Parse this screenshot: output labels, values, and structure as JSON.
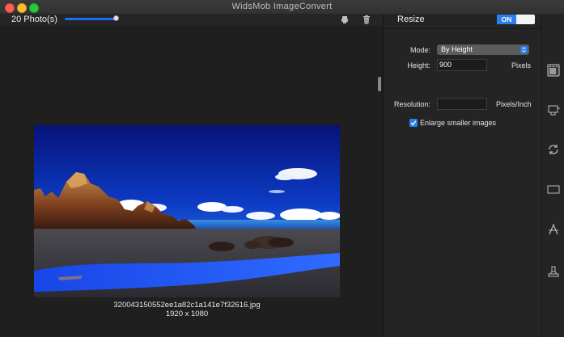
{
  "window": {
    "title": "WidsMob ImageConvert"
  },
  "toolbar": {
    "photo_count": "20 Photo(s)",
    "thumbnail_size": 1.0,
    "icons": [
      "edit-icon",
      "trash-icon"
    ]
  },
  "preview": {
    "file_name": "320043150552ee1a82c1a141e7f32616.jpg",
    "dimensions": "1920 x 1080"
  },
  "resize_panel": {
    "title": "Resize",
    "toggle_label": "ON",
    "mode_label": "Mode:",
    "mode_value": "By Height",
    "height_label": "Height:",
    "height_value": "900",
    "height_unit": "Pixels",
    "resolution_label": "Resolution:",
    "resolution_value": "",
    "resolution_unit": "Pixels/Inch",
    "enlarge_label": "Enlarge smaller images",
    "enlarge_checked": true
  },
  "icon_strip": [
    "resize-icon",
    "convert-icon",
    "rotate-icon",
    "crop-icon",
    "text-watermark-icon",
    "stamp-icon"
  ],
  "colors": {
    "accent": "#2a80ea",
    "background": "#1f1f1f"
  }
}
